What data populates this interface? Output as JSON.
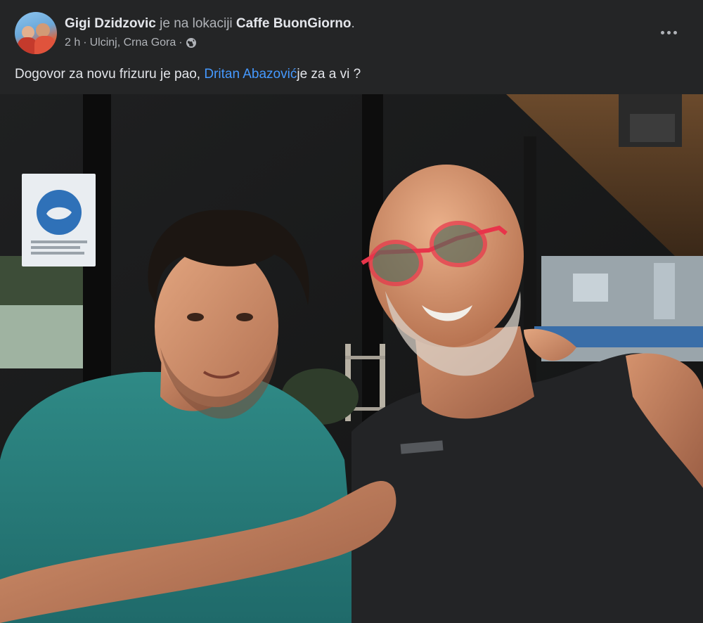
{
  "post": {
    "author": "Gigi Dzidzovic",
    "location_prefix": "je na lokaciji",
    "location": "Caffe BuonGiorno",
    "period": ".",
    "time": "2 h",
    "separator": "·",
    "place": "Ulcinj, Crna Gora",
    "text_before": "Dogovor za novu frizuru je pao,",
    "mention": "Dritan Abazović",
    "text_after": "je za a vi ?",
    "privacy_icon": "globe-icon",
    "menu_icon": "more-options-icon"
  },
  "colors": {
    "background": "#242526",
    "primary_text": "#e4e6eb",
    "secondary_text": "#b0b3b8",
    "mention_link": "#4599ff"
  }
}
